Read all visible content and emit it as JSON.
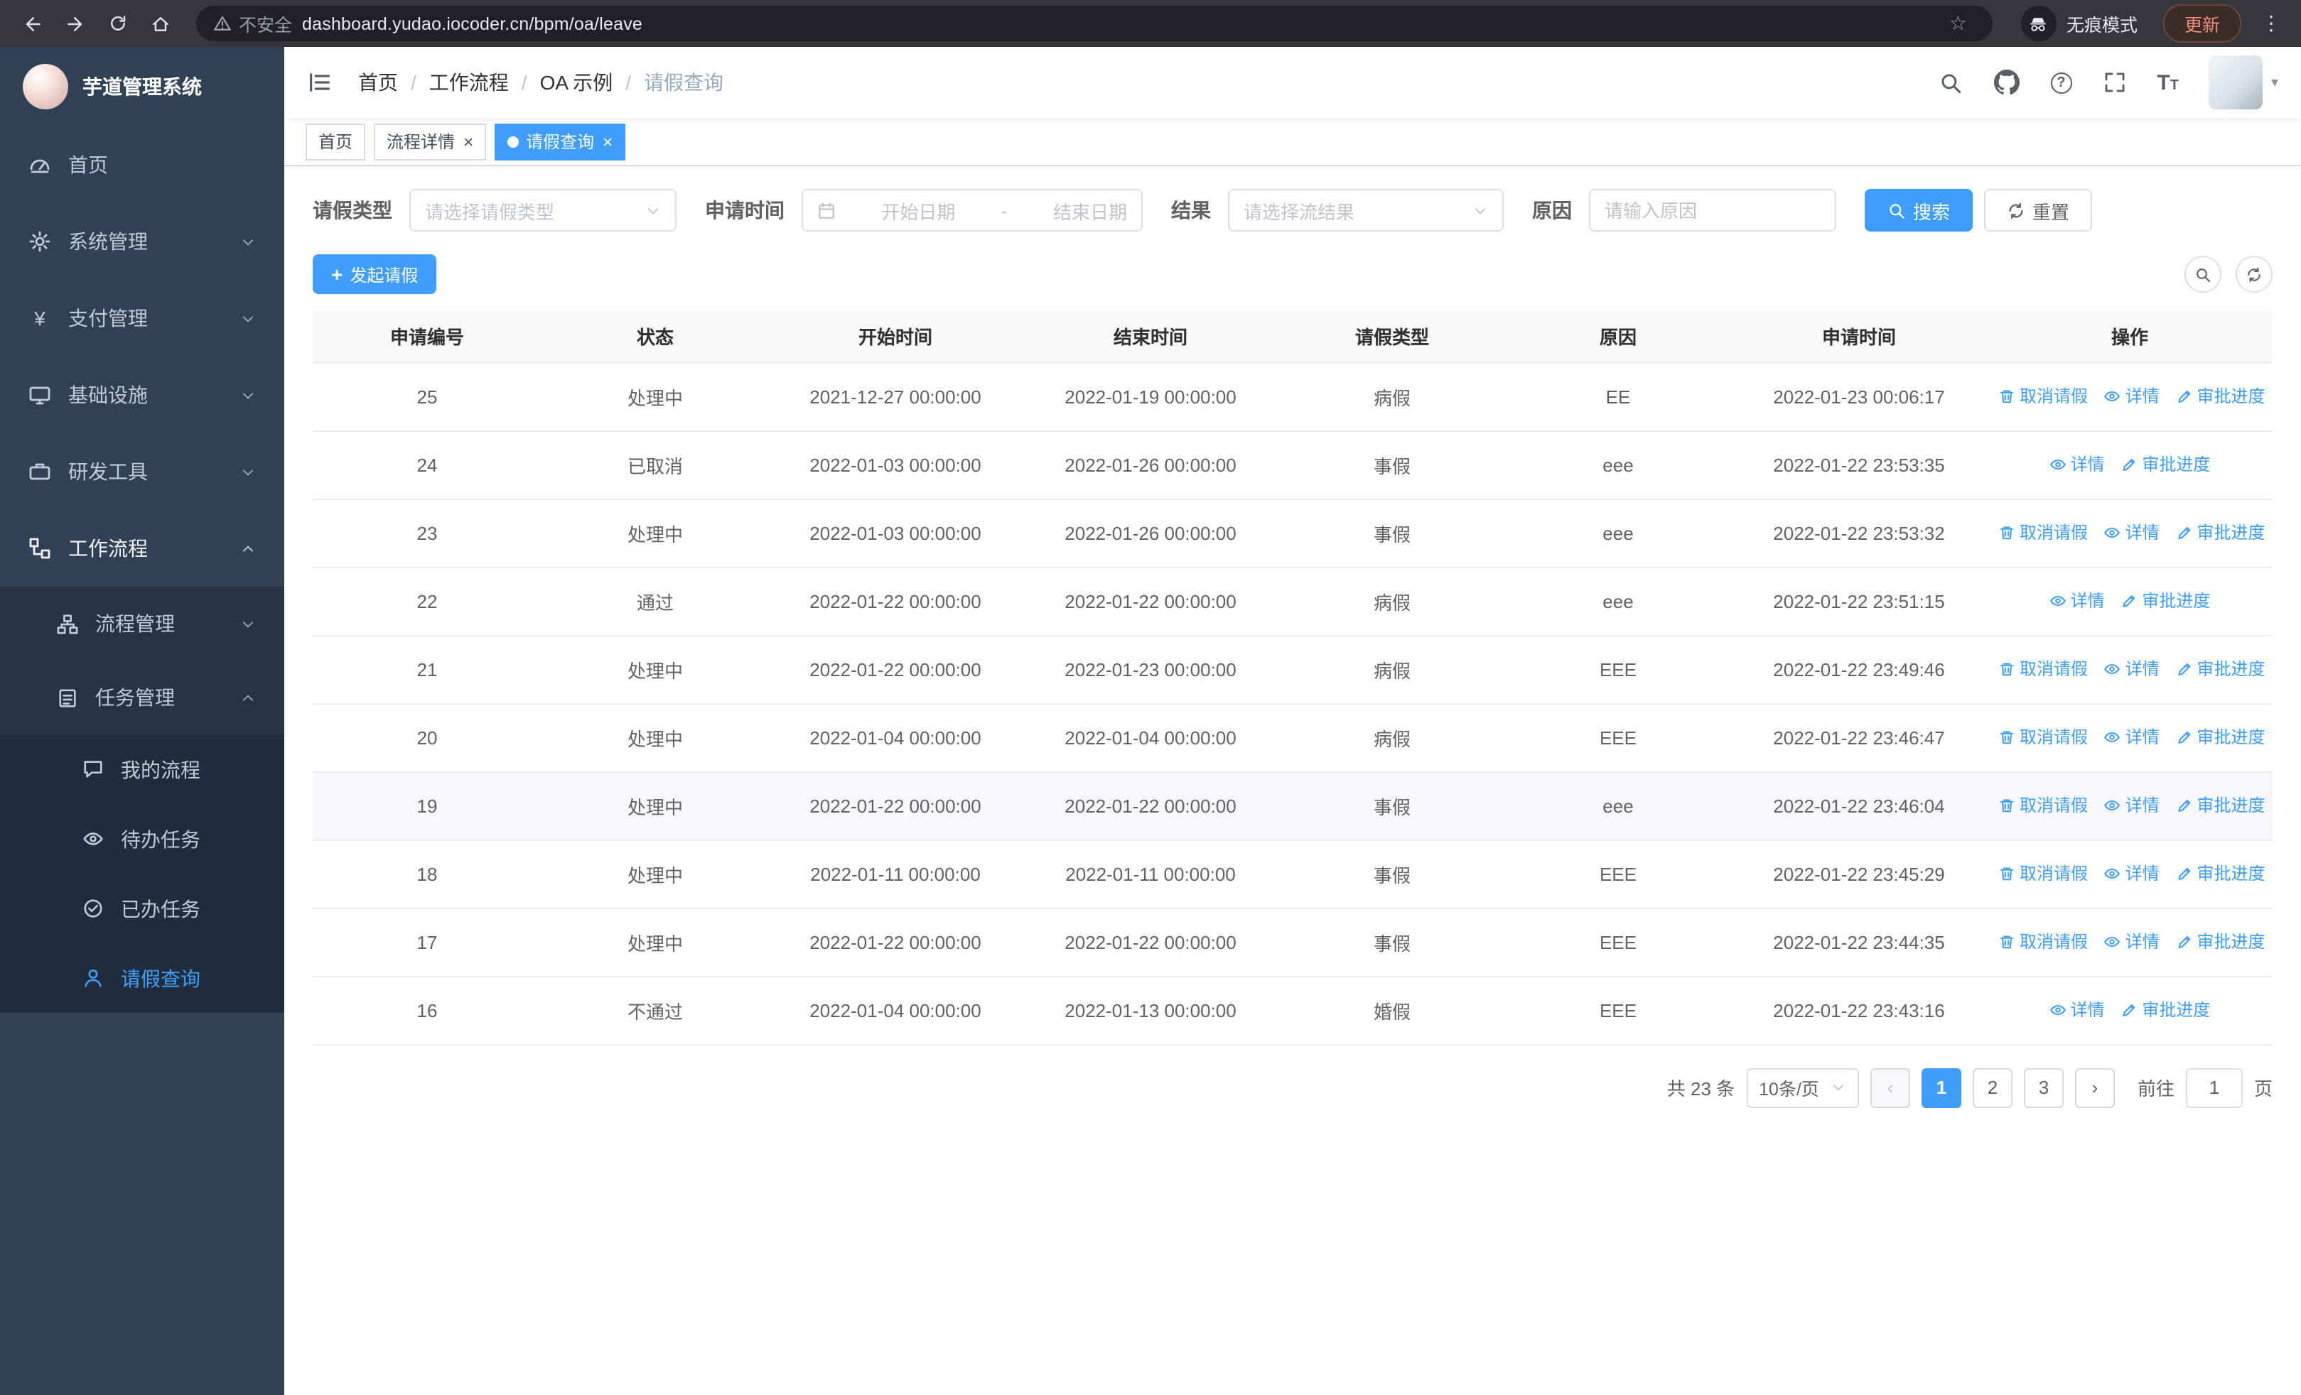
{
  "browser": {
    "security_label": "不安全",
    "url": "dashboard.yudao.iocoder.cn/bpm/oa/leave",
    "incognito_label": "无痕模式",
    "update_label": "更新"
  },
  "icons": {
    "star": "☆",
    "kebab": "⋮",
    "close": "×",
    "plus": "+",
    "caret": "▾",
    "yen": "¥",
    "question": "?",
    "font_big": "T",
    "font_small": "T",
    "prev": "‹",
    "next": "›",
    "breadcrumb_separator": "/"
  },
  "sidebar": {
    "app_title": "芋道管理系统",
    "items": [
      {
        "label": "首页"
      },
      {
        "label": "系统管理"
      },
      {
        "label": "支付管理"
      },
      {
        "label": "基础设施"
      },
      {
        "label": "研发工具"
      },
      {
        "label": "工作流程"
      }
    ],
    "sub_items": [
      {
        "label": "流程管理"
      },
      {
        "label": "任务管理"
      }
    ],
    "leaf_items": [
      {
        "label": "我的流程"
      },
      {
        "label": "待办任务"
      },
      {
        "label": "已办任务"
      },
      {
        "label": "请假查询",
        "active": true
      }
    ]
  },
  "header": {
    "breadcrumb": [
      "首页",
      "工作流程",
      "OA 示例",
      "请假查询"
    ]
  },
  "tabs": [
    {
      "label": "首页"
    },
    {
      "label": "流程详情"
    },
    {
      "label": "请假查询"
    }
  ],
  "filters": {
    "leave_type_label": "请假类型",
    "leave_type_placeholder": "请选择请假类型",
    "apply_time_label": "申请时间",
    "start_date_placeholder": "开始日期",
    "range_separator": "-",
    "end_date_placeholder": "结束日期",
    "result_label": "结果",
    "result_placeholder": "请选择流结果",
    "reason_label": "原因",
    "reason_placeholder": "请输入原因",
    "search_label": "搜索",
    "reset_label": "重置"
  },
  "toolbar": {
    "create_label": "发起请假"
  },
  "table": {
    "columns": [
      "申请编号",
      "状态",
      "开始时间",
      "结束时间",
      "请假类型",
      "原因",
      "申请时间",
      "操作"
    ],
    "ops_labels": {
      "cancel": "取消请假",
      "detail": "详情",
      "progress": "审批进度"
    },
    "rows": [
      {
        "id": "25",
        "status": "处理中",
        "start": "2021-12-27 00:00:00",
        "end": "2022-01-19 00:00:00",
        "type": "病假",
        "reason": "EE",
        "applied": "2022-01-23 00:06:17",
        "ops": [
          "cancel",
          "detail",
          "progress"
        ]
      },
      {
        "id": "24",
        "status": "已取消",
        "start": "2022-01-03 00:00:00",
        "end": "2022-01-26 00:00:00",
        "type": "事假",
        "reason": "eee",
        "applied": "2022-01-22 23:53:35",
        "ops": [
          "detail",
          "progress"
        ]
      },
      {
        "id": "23",
        "status": "处理中",
        "start": "2022-01-03 00:00:00",
        "end": "2022-01-26 00:00:00",
        "type": "事假",
        "reason": "eee",
        "applied": "2022-01-22 23:53:32",
        "ops": [
          "cancel",
          "detail",
          "progress"
        ]
      },
      {
        "id": "22",
        "status": "通过",
        "start": "2022-01-22 00:00:00",
        "end": "2022-01-22 00:00:00",
        "type": "病假",
        "reason": "eee",
        "applied": "2022-01-22 23:51:15",
        "ops": [
          "detail",
          "progress"
        ]
      },
      {
        "id": "21",
        "status": "处理中",
        "start": "2022-01-22 00:00:00",
        "end": "2022-01-23 00:00:00",
        "type": "病假",
        "reason": "EEE",
        "applied": "2022-01-22 23:49:46",
        "ops": [
          "cancel",
          "detail",
          "progress"
        ]
      },
      {
        "id": "20",
        "status": "处理中",
        "start": "2022-01-04 00:00:00",
        "end": "2022-01-04 00:00:00",
        "type": "病假",
        "reason": "EEE",
        "applied": "2022-01-22 23:46:47",
        "ops": [
          "cancel",
          "detail",
          "progress"
        ]
      },
      {
        "id": "19",
        "status": "处理中",
        "start": "2022-01-22 00:00:00",
        "end": "2022-01-22 00:00:00",
        "type": "事假",
        "reason": "eee",
        "applied": "2022-01-22 23:46:04",
        "ops": [
          "cancel",
          "detail",
          "progress"
        ],
        "highlighted": true
      },
      {
        "id": "18",
        "status": "处理中",
        "start": "2022-01-11 00:00:00",
        "end": "2022-01-11 00:00:00",
        "type": "事假",
        "reason": "EEE",
        "applied": "2022-01-22 23:45:29",
        "ops": [
          "cancel",
          "detail",
          "progress"
        ]
      },
      {
        "id": "17",
        "status": "处理中",
        "start": "2022-01-22 00:00:00",
        "end": "2022-01-22 00:00:00",
        "type": "事假",
        "reason": "EEE",
        "applied": "2022-01-22 23:44:35",
        "ops": [
          "cancel",
          "detail",
          "progress"
        ]
      },
      {
        "id": "16",
        "status": "不通过",
        "start": "2022-01-04 00:00:00",
        "end": "2022-01-13 00:00:00",
        "type": "婚假",
        "reason": "EEE",
        "applied": "2022-01-22 23:43:16",
        "ops": [
          "detail",
          "progress"
        ]
      }
    ]
  },
  "pagination": {
    "total_label": "共 23 条",
    "page_size": "10条/页",
    "pages": [
      "1",
      "2",
      "3"
    ],
    "active_page": "1",
    "goto_label": "前往",
    "goto_value": "1",
    "page_suffix": "页"
  },
  "colors": {
    "primary": "#409eff",
    "sidebar_bg": "#304156",
    "submenu_bg": "#263445",
    "submenu_deep_bg": "#1f2d3d",
    "table_header_bg": "#f8f8f9",
    "border": "#ebeef5"
  }
}
